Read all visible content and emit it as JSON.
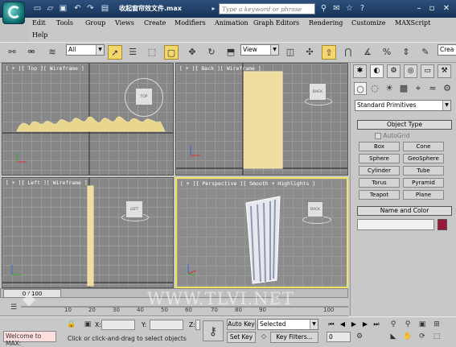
{
  "title": {
    "filename": "收起窗帘效文件.max",
    "search_placeholder": "Type a keyword or phrase"
  },
  "menu": [
    "Edit",
    "Tools",
    "Group",
    "Views",
    "Create",
    "Modifiers",
    "Animation",
    "Graph Editors",
    "Rendering",
    "Customize",
    "MAXScript",
    "Help"
  ],
  "toolbar": {
    "selection_filter": "All",
    "ref_coord": "View",
    "named_sel": "Crea"
  },
  "viewports": {
    "top": "[ + ][ Top ][ Wireframe ]",
    "back": "[ + ][ Back ][ Wireframe ]",
    "left": "[ + ][ Left ][ Wireframe ]",
    "persp": "[ + ][ Perspective ][ Smooth + Highlights ]",
    "cube_top": "TOP",
    "cube_back": "BACK",
    "cube_left": "LEFT"
  },
  "command_panel": {
    "category": "Standard Primitives",
    "object_type_title": "Object Type",
    "autogrid": "AutoGrid",
    "buttons": [
      "Box",
      "Cone",
      "Sphere",
      "GeoSphere",
      "Cylinder",
      "Tube",
      "Torus",
      "Pyramid",
      "Teapot",
      "Plane"
    ],
    "name_color_title": "Name and Color",
    "swatch_color": "#9b1738"
  },
  "timeline": {
    "slider": "0 / 100",
    "ticks": [
      "10",
      "20",
      "30",
      "40",
      "50",
      "60",
      "70",
      "80",
      "90",
      "100"
    ],
    "watermark": "WWW.TLVI.NET"
  },
  "status": {
    "maxscript": "Welcome to MAX:",
    "prompt": "Click or click-and-drag to select objects",
    "x_label": "X:",
    "y_label": "Y:",
    "z_label": "Z:",
    "auto_key": "Auto Key",
    "set_key": "Set Key",
    "key_mode": "Selected",
    "key_filters": "Key Filters...",
    "frame": "0"
  }
}
